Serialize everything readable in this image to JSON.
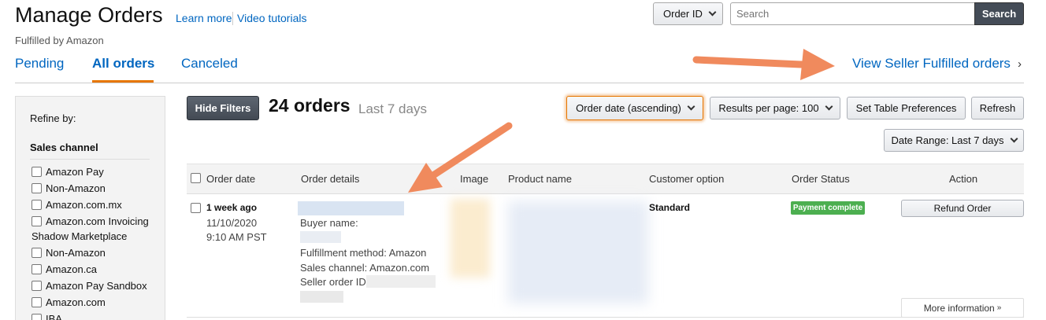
{
  "header": {
    "title": "Manage Orders",
    "learn_more": "Learn more",
    "video_tutorials": "Video tutorials",
    "subtitle": "Fulfilled by Amazon"
  },
  "search": {
    "filter_label": "Order ID",
    "placeholder": "Search",
    "button_label": "Search"
  },
  "tabs": [
    {
      "label": "Pending",
      "active": false
    },
    {
      "label": "All orders",
      "active": true
    },
    {
      "label": "Canceled",
      "active": false
    }
  ],
  "view_seller_fulfilled": "View Seller Fulfilled orders",
  "sidebar": {
    "refine_by": "Refine by:",
    "section_title": "Sales channel",
    "items": [
      {
        "label": "Amazon Pay"
      },
      {
        "label": "Non-Amazon"
      },
      {
        "label": "Amazon.com.mx"
      },
      {
        "label": "Amazon.com Invoicing",
        "continuation": "Shadow Marketplace"
      },
      {
        "label": "Non-Amazon"
      },
      {
        "label": "Amazon.ca"
      },
      {
        "label": "Amazon Pay Sandbox"
      },
      {
        "label": "Amazon.com"
      },
      {
        "label": "IBA"
      }
    ]
  },
  "toolbar": {
    "hide_filters": "Hide Filters",
    "orders_count": "24 orders",
    "period": "Last 7 days",
    "sort_label": "Order date (ascending)",
    "results_per_page": "Results per page: 100",
    "set_table_prefs": "Set Table Preferences",
    "refresh": "Refresh",
    "date_range": "Date Range: Last 7 days"
  },
  "table": {
    "columns": [
      "Order date",
      "Order details",
      "Image",
      "Product name",
      "Customer option",
      "Order Status",
      "Action"
    ],
    "rows": [
      {
        "relative_date": "1 week ago",
        "date": "11/10/2020",
        "time": "9:10 AM PST",
        "buyer_name_label": "Buyer name:",
        "fulfillment": "Fulfillment method: Amazon",
        "sales_channel": "Sales channel: Amazon.com",
        "seller_order_id_label": "Seller order ID:",
        "customer_option": "Standard",
        "status": "Payment complete",
        "action": "Refund Order",
        "more_info": "More information"
      }
    ]
  },
  "colors": {
    "link": "#0066c0",
    "accent": "#e77600",
    "status_green": "#4caf50",
    "arrow": "#f08a5d"
  },
  "icons": [
    "chevron-down-icon",
    "chevron-right-icon",
    "double-chevron-down-icon",
    "annotation-arrow"
  ]
}
